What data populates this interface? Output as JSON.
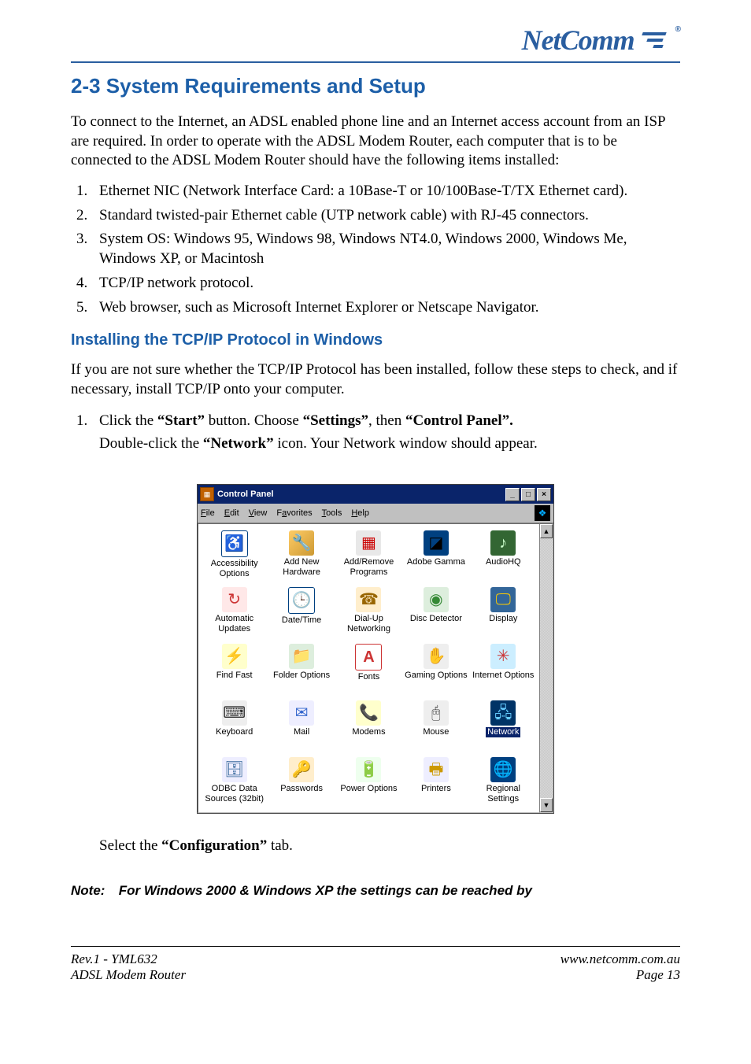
{
  "header": {
    "brand": "NetComm",
    "reg": "®"
  },
  "section": {
    "title": "2-3 System Requirements and Setup",
    "intro": "To connect to the Internet, an ADSL enabled phone line and an Internet access account from an ISP are required. In order to operate with the ADSL Modem Router, each computer that is to be connected to the ADSL Modem Router should have the following items installed:",
    "requirements": [
      "Ethernet NIC (Network Interface Card: a 10Base-T or 10/100Base-T/TX Ethernet card).",
      "Standard twisted-pair Ethernet cable (UTP network cable) with RJ-45 connectors.",
      "System OS: Windows 95, Windows 98, Windows NT4.0, Windows 2000, Windows Me, Windows XP, or Macintosh",
      "TCP/IP network protocol.",
      "Web browser, such as Microsoft Internet Explorer or Netscape Navigator."
    ]
  },
  "install": {
    "title": "Installing the TCP/IP Protocol in Windows",
    "intro": "If you are not sure whether the TCP/IP Protocol has been installed, follow these steps to check, and if necessary, install TCP/IP onto your computer.",
    "step1_parts": {
      "p1": "Click the ",
      "b1": "“Start”",
      "p2": " button. Choose ",
      "b2": "“Settings”",
      "p3": ", then ",
      "b3": "“Control Panel”."
    },
    "step1_sub_parts": {
      "p1": "Double-click the ",
      "b1": "“Network”",
      "p2": " icon. Your Network window should appear."
    },
    "after_parts": {
      "p1": "Select the ",
      "b1": "“Configuration”",
      "p2": " tab."
    }
  },
  "cp": {
    "title": "Control Panel",
    "menu": {
      "file": "File",
      "edit": "Edit",
      "view": "View",
      "fav": "Favorites",
      "tools": "Tools",
      "help": "Help"
    },
    "items": [
      {
        "label": "Accessibility Options",
        "glyph": "♿",
        "cls": "access"
      },
      {
        "label": "Add New Hardware",
        "glyph": "🔧",
        "cls": "addhw"
      },
      {
        "label": "Add/Remove Programs",
        "glyph": "▦",
        "cls": "addrm"
      },
      {
        "label": "Adobe Gamma",
        "glyph": "◪",
        "cls": "gamma"
      },
      {
        "label": "AudioHQ",
        "glyph": "♪",
        "cls": "audio"
      },
      {
        "label": "Automatic Updates",
        "glyph": "↻",
        "cls": "auto"
      },
      {
        "label": "Date/Time",
        "glyph": "🕒",
        "cls": "date"
      },
      {
        "label": "Dial-Up Networking",
        "glyph": "☎",
        "cls": "dialup"
      },
      {
        "label": "Disc Detector",
        "glyph": "◉",
        "cls": "disc"
      },
      {
        "label": "Display",
        "glyph": "🖵",
        "cls": "display"
      },
      {
        "label": "Find Fast",
        "glyph": "⚡",
        "cls": "find"
      },
      {
        "label": "Folder Options",
        "glyph": "📁",
        "cls": "folder"
      },
      {
        "label": "Fonts",
        "glyph": "A",
        "cls": "fonts"
      },
      {
        "label": "Gaming Options",
        "glyph": "✋",
        "cls": "gaming"
      },
      {
        "label": "Internet Options",
        "glyph": "✳",
        "cls": "inet"
      },
      {
        "label": "Keyboard",
        "glyph": "⌨",
        "cls": "kb"
      },
      {
        "label": "Mail",
        "glyph": "✉",
        "cls": "mail"
      },
      {
        "label": "Modems",
        "glyph": "📞",
        "cls": "modem"
      },
      {
        "label": "Mouse",
        "glyph": "🖰",
        "cls": "mouse"
      },
      {
        "label": "Network",
        "glyph": "🖧",
        "cls": "net",
        "selected": true
      },
      {
        "label": "ODBC Data Sources (32bit)",
        "glyph": "🗄",
        "cls": "odbc"
      },
      {
        "label": "Passwords",
        "glyph": "🔑",
        "cls": "pwd"
      },
      {
        "label": "Power Options",
        "glyph": "🔋",
        "cls": "power"
      },
      {
        "label": "Printers",
        "glyph": "🖶",
        "cls": "print"
      },
      {
        "label": "Regional Settings",
        "glyph": "🌐",
        "cls": "region"
      }
    ],
    "winbtns": {
      "min": "_",
      "max": "□",
      "close": "×"
    },
    "scroll": {
      "up": "▲",
      "down": "▼"
    }
  },
  "note": {
    "label": "Note:",
    "text": "For Windows 2000 & Windows XP the settings can be reached by"
  },
  "footer": {
    "left1": "Rev.1 - YML632",
    "left2": "ADSL Modem Router",
    "right1": "www.netcomm.com.au",
    "right2": "Page 13"
  }
}
